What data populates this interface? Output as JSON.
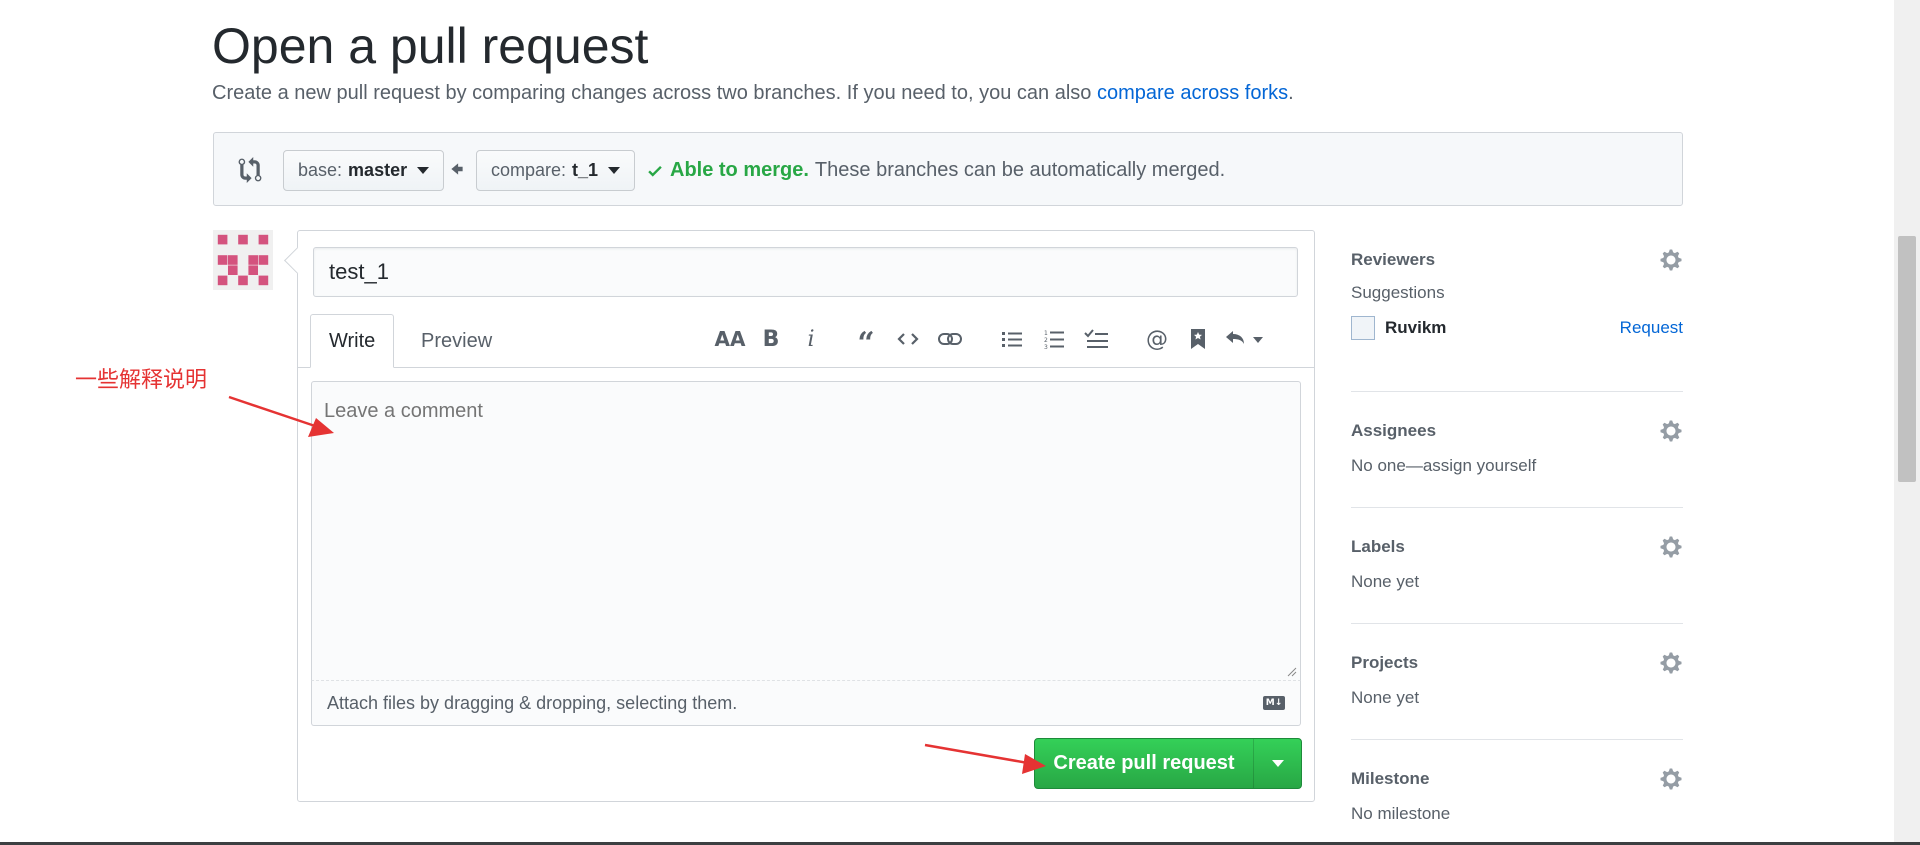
{
  "page": {
    "title": "Open a pull request",
    "subtitle": "Create a new pull request by comparing changes across two branches. If you need to, you can also ",
    "subtitle_link": "compare across forks",
    "subtitle_end": "."
  },
  "compare": {
    "base_key": "base:",
    "base_value": "master",
    "compare_key": "compare:",
    "compare_value": "t_1",
    "merge_ok": "Able to merge.",
    "merge_text": "These branches can be automatically merged."
  },
  "form": {
    "title_value": "test_1",
    "tabs": {
      "write": "Write",
      "preview": "Preview"
    },
    "textarea_placeholder": "Leave a comment",
    "attach_text": "Attach files by dragging & dropping, selecting them.",
    "submit_label": "Create pull request"
  },
  "toolbar": {
    "icons": [
      "header-icon",
      "bold-icon",
      "italic-icon",
      "quote-icon",
      "code-icon",
      "link-icon",
      "unordered-list-icon",
      "ordered-list-icon",
      "task-list-icon",
      "mention-icon",
      "bookmark-icon",
      "reply-icon"
    ]
  },
  "sidebar": {
    "reviewers": {
      "heading": "Reviewers",
      "sub": "Suggestions",
      "name": "Ruvikm",
      "action": "Request"
    },
    "assignees": {
      "heading": "Assignees",
      "body": "No one—assign yourself"
    },
    "labels": {
      "heading": "Labels",
      "body": "None yet"
    },
    "projects": {
      "heading": "Projects",
      "body": "None yet"
    },
    "milestone": {
      "heading": "Milestone",
      "body": "No milestone"
    }
  },
  "annotation": {
    "text": "一些解释说明"
  },
  "colors": {
    "accent": "#0366d6",
    "success": "#28a745",
    "annotation": "#e53333"
  }
}
